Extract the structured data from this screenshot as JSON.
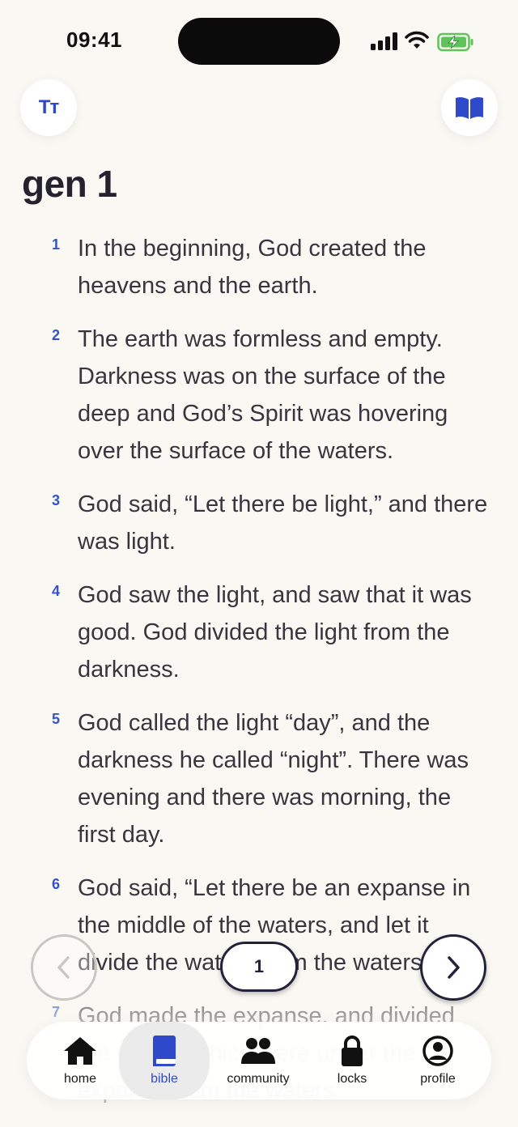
{
  "status_bar": {
    "time": "09:41"
  },
  "header": {
    "text_size_icon": "Tт",
    "title": "gen 1"
  },
  "verses": [
    {
      "num": "1",
      "text": "In the beginning, God created the heavens and the earth."
    },
    {
      "num": "2",
      "text": "The earth was formless and empty. Darkness was on the surface of the deep and God’s Spirit was hovering over the surface of the waters."
    },
    {
      "num": "3",
      "text": "God said, “Let there be light,” and there was light."
    },
    {
      "num": "4",
      "text": "God saw the light, and saw that it was good. God divided the light from the darkness."
    },
    {
      "num": "5",
      "text": "God called the light “day”, and the darkness he called “night”. There was evening and there was morning, the first day."
    },
    {
      "num": "6",
      "text": "God said, “Let there be an expanse in the middle of the waters, and let it divide the waters from the waters.”"
    },
    {
      "num": "7",
      "text": "God made the expanse, and divided the waters which were under the expanse from the waters"
    }
  ],
  "chapter_nav": {
    "current": "1"
  },
  "tabs": [
    {
      "label": "home",
      "icon": "home-icon"
    },
    {
      "label": "bible",
      "icon": "bible-icon",
      "active": true
    },
    {
      "label": "community",
      "icon": "people-icon"
    },
    {
      "label": "locks",
      "icon": "lock-icon"
    },
    {
      "label": "profile",
      "icon": "profile-icon"
    }
  ],
  "colors": {
    "accent": "#2e49c9",
    "background": "#faf8f3",
    "dark": "#22223b"
  }
}
